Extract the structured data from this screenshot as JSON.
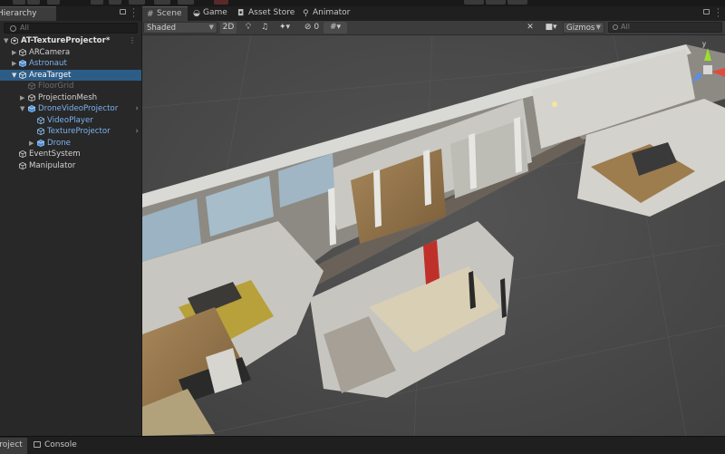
{
  "hierarchy": {
    "tab_label": "Hierarchy",
    "search_placeholder": "All",
    "scene_root": "AT-TextureProjector*",
    "items": [
      {
        "label": "ARCamera"
      },
      {
        "label": "Astronaut"
      },
      {
        "label": "AreaTarget"
      },
      {
        "label": "FloorGrid"
      },
      {
        "label": "ProjectionMesh"
      },
      {
        "label": "DroneVideoProjector"
      },
      {
        "label": "VideoPlayer"
      },
      {
        "label": "TextureProjector"
      },
      {
        "label": "Drone"
      },
      {
        "label": "EventSystem"
      },
      {
        "label": "Manipulator"
      }
    ]
  },
  "scene_tabs": [
    {
      "label": "Scene",
      "icon": "grid-icon"
    },
    {
      "label": "Game",
      "icon": "gamepad-icon"
    },
    {
      "label": "Asset Store",
      "icon": "bag-icon"
    },
    {
      "label": "Animator",
      "icon": "animator-icon"
    }
  ],
  "scene_toolbar": {
    "shading_mode": "Shaded",
    "mode_2d": "2D",
    "hidden_count": "0",
    "gizmos_label": "Gizmos",
    "search_placeholder": "All"
  },
  "gizmo": {
    "axis_y": "y"
  },
  "bottom_tabs": [
    {
      "label": "Project",
      "icon": "folder-icon"
    },
    {
      "label": "Console",
      "icon": "console-icon"
    }
  ],
  "colors": {
    "selection": "#2c5d87",
    "prefab_blue": "#7cb2f0",
    "viewport_bg": "#4a4a4a"
  }
}
